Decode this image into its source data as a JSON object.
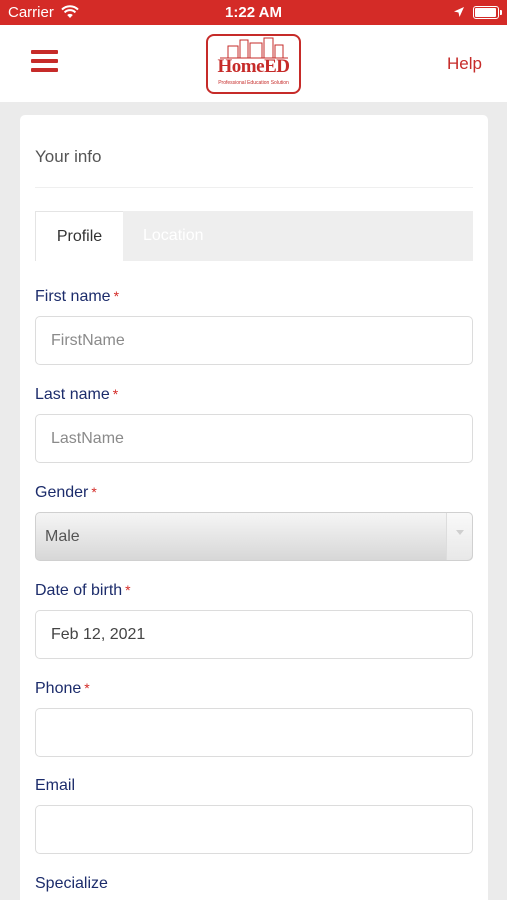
{
  "status_bar": {
    "carrier": "Carrier",
    "time": "1:22 AM",
    "icons": [
      "wifi-icon",
      "location-arrow-icon",
      "battery-icon"
    ]
  },
  "header": {
    "menu_icon": "hamburger-menu-icon",
    "logo_text": "HomeED",
    "logo_tagline": "Professional Education Solution",
    "help_label": "Help"
  },
  "form": {
    "title": "Your info",
    "tabs": [
      {
        "label": "Profile",
        "active": true
      },
      {
        "label": "Location",
        "active": false
      }
    ],
    "fields": {
      "first_name": {
        "label": "First name",
        "required": "*",
        "placeholder": "FirstName",
        "value": ""
      },
      "last_name": {
        "label": "Last name",
        "required": "*",
        "placeholder": "LastName",
        "value": ""
      },
      "gender": {
        "label": "Gender",
        "required": "*",
        "value": "Male"
      },
      "date_of_birth": {
        "label": "Date of birth",
        "required": "*",
        "value": "Feb 12, 2021"
      },
      "phone": {
        "label": "Phone",
        "required": "*",
        "value": ""
      },
      "email": {
        "label": "Email",
        "value": ""
      },
      "specialize": {
        "label": "Specialize"
      }
    }
  },
  "colors": {
    "brand_red": "#d42b27",
    "label_navy": "#1c2c6b",
    "background": "#ebebeb"
  }
}
